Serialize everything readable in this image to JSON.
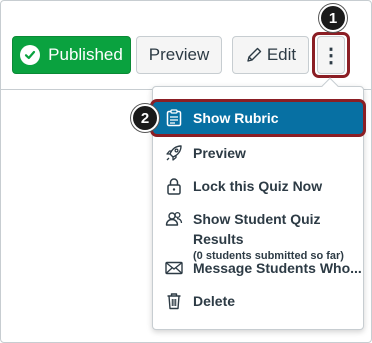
{
  "toolbar": {
    "published_label": "Published",
    "preview_label": "Preview",
    "edit_label": "Edit",
    "more_glyph": "⋮"
  },
  "steps": {
    "step1": "1",
    "step2": "2"
  },
  "menu": {
    "items": [
      {
        "label": "Show Rubric",
        "icon": "rubric-icon"
      },
      {
        "label": "Preview",
        "icon": "rocket-icon"
      },
      {
        "label": "Lock this Quiz Now",
        "icon": "lock-icon"
      },
      {
        "label": "Show Student Quiz Results",
        "sublabel": "(0 students submitted so far)",
        "icon": "users-icon"
      },
      {
        "label": "Message Students Who...",
        "icon": "envelope-icon"
      },
      {
        "label": "Delete",
        "icon": "trash-icon"
      }
    ]
  },
  "colors": {
    "published_green": "#0aa23f",
    "menu_active_blue": "#0770a3",
    "highlight_red": "#8b1e24",
    "text_dark": "#2d3b45"
  }
}
